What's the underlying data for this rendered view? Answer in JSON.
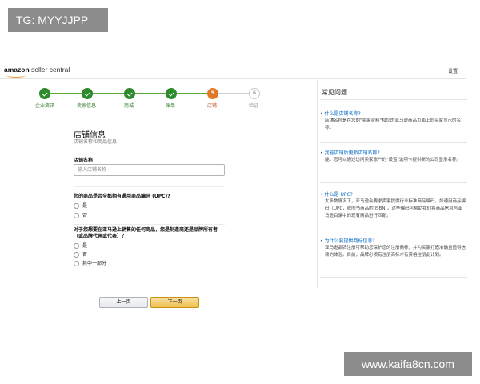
{
  "watermarks": {
    "top_left": "TG: MYYJJPP",
    "bottom_right": "www.kaifa8cn.com"
  },
  "header": {
    "logo_brand": "amazon",
    "logo_product": " seller central",
    "settings_label": "设置"
  },
  "stepper": {
    "steps": [
      {
        "number": "1",
        "label": "企业资讯",
        "status": "done"
      },
      {
        "number": "2",
        "label": "卖家信息",
        "status": "done"
      },
      {
        "number": "3",
        "label": "商城",
        "status": "done"
      },
      {
        "number": "4",
        "label": "账单",
        "status": "done"
      },
      {
        "number": "5",
        "label": "店铺",
        "status": "current"
      },
      {
        "number": "6",
        "label": "验证",
        "status": "todo"
      }
    ]
  },
  "form": {
    "title": "店铺信息",
    "subtitle": "店铺名称和商品信息",
    "store_name_label": "店铺名称",
    "store_name_placeholder": "输入店铺名称",
    "upc_question": "您的商品是否全都拥有通用商品编码 (UPC)?",
    "upc_options": [
      "是",
      "否"
    ],
    "brand_question_line1": "对于您想要在亚马逊上销售的任何商品，您是制造商还是品牌所有者",
    "brand_question_line2": "（或品牌代理或代表）？",
    "brand_options": [
      "是",
      "否",
      "其中一部分"
    ],
    "prev_button": "上一页",
    "next_button": "下一页"
  },
  "faq": {
    "title": "常见问题",
    "items": [
      {
        "question": "什么是店铺名称?",
        "answer": "店铺名称是在您的\"卖家资料\"和您的亚马逊商品页面上向买家显示的名称。"
      },
      {
        "question": "我能店铺后更新店铺名称?",
        "answer": "能。您可以通过访问卖家账户的\"设置\"选项卡提供新的公司显示名称。"
      },
      {
        "question": "什么是 UPC?",
        "answer": "大多数情况下，亚马逊会要求卖家提供行业标准商品编码，如通用商品编码（UPC，或图书商品的 ISBN）。这些编码可帮助我们将商品信息与亚马逊目录中的现有商品进行匹配。"
      },
      {
        "question": "为什么要提供商标信息?",
        "answer": "亚马逊品牌注册可帮助您保护您的注册商标，并为买家打造准确且值得信赖的体验。目前，品牌必须有注册商标才有资格注册此计划。"
      }
    ]
  }
}
